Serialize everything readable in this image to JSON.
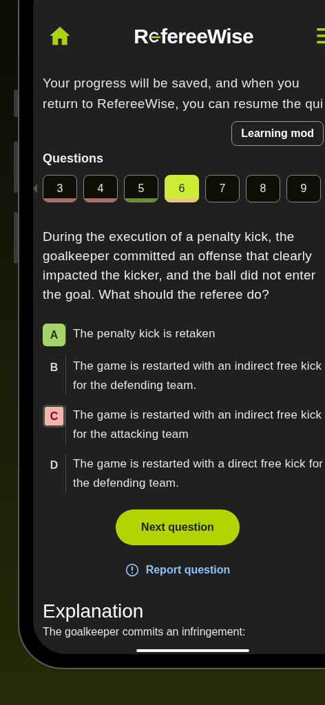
{
  "header": {
    "logo_start": "R",
    "logo_end": "fereeWise"
  },
  "notice": "Your progress will be saved, and when you return to RefereeWise, you can resume the qui",
  "mode_button": "Learning mod",
  "questions_label": "Questions",
  "question_chips": [
    {
      "label": "3",
      "selected": false,
      "kind": "wrong"
    },
    {
      "label": "4",
      "selected": false,
      "kind": "wrong"
    },
    {
      "label": "5",
      "selected": false,
      "kind": "correct"
    },
    {
      "label": "6",
      "selected": true,
      "kind": "current"
    },
    {
      "label": "7",
      "selected": false,
      "kind": "open"
    },
    {
      "label": "8",
      "selected": false,
      "kind": "open"
    },
    {
      "label": "9",
      "selected": false,
      "kind": "open"
    }
  ],
  "question": "During the execution of a penalty kick, the goalkeeper committed an offense that clearly impacted the kicker, and the ball did not enter the goal. What should the referee do?",
  "answers": [
    {
      "letter": "A",
      "text": "The penalty kick is retaken",
      "kind": "correct"
    },
    {
      "letter": "B",
      "text": "The game is restarted with an indirect free kick for the defending team.",
      "kind": "plain"
    },
    {
      "letter": "C",
      "text": "The game is restarted with an indirect free kick for the attacking team",
      "kind": "wrong"
    },
    {
      "letter": "D",
      "text": "The game is restarted with a direct free kick for the defending team.",
      "kind": "plain"
    }
  ],
  "next_button": "Next question",
  "report_link": "Report question",
  "explanation": {
    "title": "Explanation",
    "text": "The goalkeeper commits an infringement:"
  }
}
